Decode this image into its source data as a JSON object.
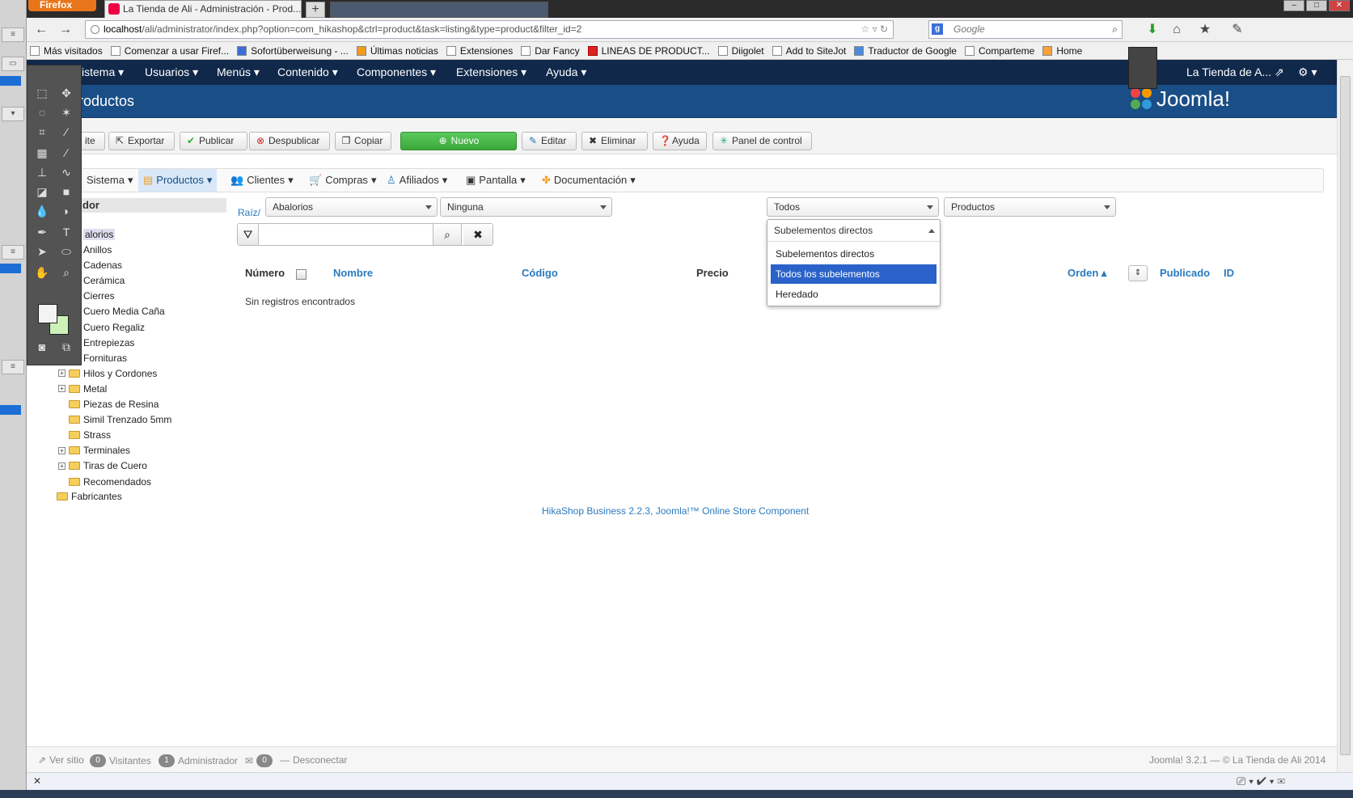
{
  "browser": {
    "app_button": "Firefox",
    "tab_title": "La Tienda de Ali - Administración - Prod...",
    "new_tab": "+",
    "url_host": "localhost",
    "url_path": "/ali/administrator/index.php?option=com_hikashop&ctrl=product&task=listing&type=product&filter_id=2",
    "search_placeholder": "Google",
    "bookmarks": [
      "Más visitados",
      "Comenzar a usar Firef...",
      "Sofortüberweisung - ...",
      "Últimas noticias",
      "Extensiones",
      "Dar Fancy",
      "LINEAS DE PRODUCT...",
      "Diigolet",
      "Add to SiteJot",
      "Traductor de Google",
      "Comparteme",
      "Home"
    ]
  },
  "joomla": {
    "menu": [
      "istema",
      "Usuarios",
      "Menús",
      "Contenido",
      "Componentes",
      "Extensiones",
      "Ayuda"
    ],
    "site_name": "La Tienda de A...",
    "page_title": "roductos",
    "logo_text": "Joomla!",
    "toolbar": {
      "partial": "ite",
      "exportar": "Exportar",
      "publicar": "Publicar",
      "despublicar": "Despublicar",
      "copiar": "Copiar",
      "nuevo": "Nuevo",
      "editar": "Editar",
      "eliminar": "Eliminar",
      "ayuda": "Ayuda",
      "panel": "Panel de control"
    },
    "submenu": {
      "sistema": "Sistema",
      "productos": "Productos",
      "clientes": "Clientes",
      "compras": "Compras",
      "afiliados": "Afiliados",
      "pantalla": "Pantalla",
      "documentacion": "Documentación"
    },
    "tree": {
      "header": "dor",
      "selected": "alorios",
      "items": [
        "Anillos",
        "Cadenas",
        "Cerámica",
        "Cierres",
        "Cuero Media Caña",
        "Cuero Regaliz",
        "Entrepiezas",
        "Fornituras",
        "Hilos y Cordones",
        "Metal",
        "Piezas de Resina",
        "Simil Trenzado 5mm",
        "Strass",
        "Terminales",
        "Tiras de Cuero",
        "Recomendados"
      ],
      "root_extra": "Fabricantes"
    },
    "filters": {
      "raiz": "Raíz/",
      "category": "Abalorios",
      "ninguna": "Ninguna",
      "todos": "Todos",
      "productos": "Productos"
    },
    "dropdown": {
      "current": "Subelementos directos",
      "options": [
        "Subelementos directos",
        "Todos los subelementos",
        "Heredado"
      ]
    },
    "table": {
      "numero": "Número",
      "nombre": "Nombre",
      "codigo": "Código",
      "precio": "Precio",
      "orden": "Orden",
      "publicado": "Publicado",
      "id": "ID",
      "empty": "Sin registros encontrados"
    },
    "credit": "HikaShop Business 2.2.3, Joomla!™ Online Store Component",
    "footer": {
      "ver_sitio": "Ver sitio",
      "visitors_count": "0",
      "visitors": "Visitantes",
      "admins_count": "1",
      "admins": "Administrador",
      "messages_count": "0",
      "logout": "Desconectar",
      "version": "Joomla! 3.2.1 — © La Tienda de Ali 2014"
    }
  },
  "colors": {
    "joomla_nav": "#10284a",
    "joomla_title": "#1a4e86",
    "nuevo_green": "#3aa83a",
    "dropdown_active": "#2a62c9",
    "link_blue": "#2a7ac0"
  }
}
